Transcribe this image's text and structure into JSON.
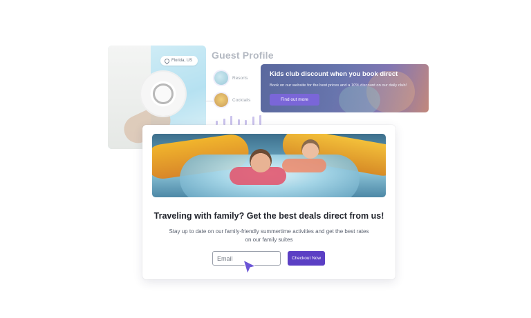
{
  "guest_profile": {
    "title": "Guest Profile",
    "location": "Florida, US",
    "interests": [
      {
        "label": "Resorts",
        "icon": "resort-thumbnail"
      },
      {
        "label": "Cocktails",
        "icon": "cocktail-thumbnail"
      }
    ],
    "activity_bars": [
      0.35,
      0.55,
      0.8,
      0.5,
      0.45,
      0.75,
      0.9
    ]
  },
  "kids_card": {
    "title": "Kids club discount when you book direct",
    "description": "Book on our website for the best prices and a 10% discount on our daily club!",
    "button_label": "Find out more"
  },
  "popup": {
    "headline": "Traveling with family? Get the best deals direct from us!",
    "subtext_line1": "Stay up to date on our family-friendly summertime activities and get the best rates",
    "subtext_line2": "on our family suites",
    "email_placeholder": "Email",
    "checkout_label": "Checkout Now"
  },
  "colors": {
    "accent": "#5b3fc4",
    "accent_light": "#7a66d8",
    "heading": "#23262e"
  }
}
